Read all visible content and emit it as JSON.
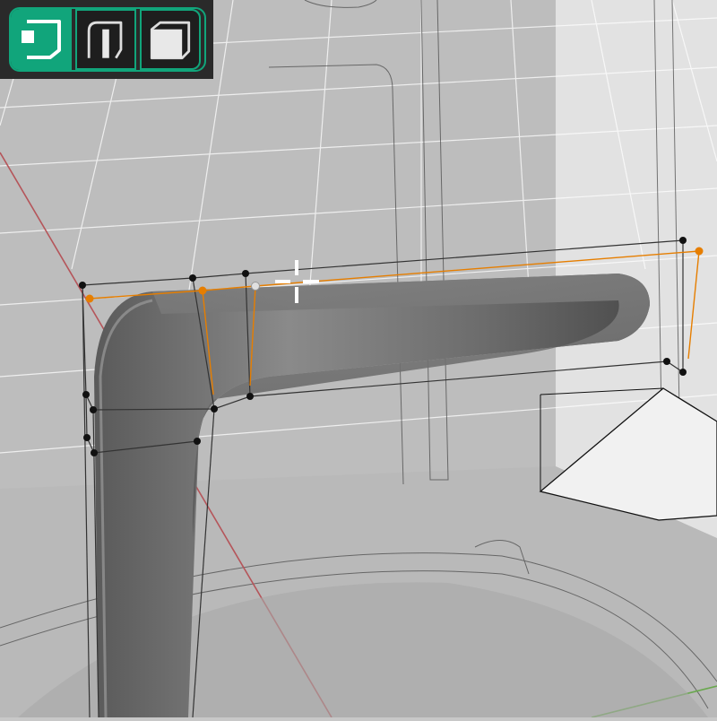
{
  "app": {
    "tool": "select-mode-toolbar",
    "accent_color": "#11a57b",
    "selection_color": "#e67e00"
  },
  "toolbar": {
    "buttons": [
      {
        "name": "vertex-select-mode",
        "icon": "vertex-select-icon",
        "active": true
      },
      {
        "name": "edge-select-mode",
        "icon": "edge-select-icon",
        "active": false
      },
      {
        "name": "face-select-mode",
        "icon": "face-select-icon",
        "active": false
      }
    ]
  },
  "viewport": {
    "object": "subdivision-surface-armrest",
    "cursor": "move-crosshair",
    "axis_x_color": "#b5555a",
    "axis_y_color": "#6aa84f"
  }
}
